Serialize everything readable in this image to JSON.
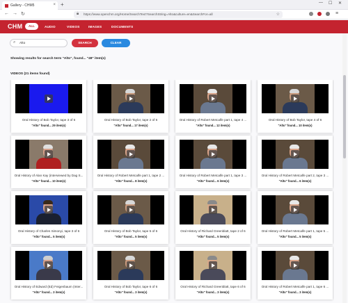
{
  "browser": {
    "tab_title": "Gallery - CHM5",
    "url": "https://www.openchm.org/Home/SearchText?SearchString=Alto&culture=en&SearchFor=all",
    "new_tab": "+",
    "tab_close": "×",
    "minimize": "—",
    "maximize": "☐",
    "close": "✕"
  },
  "site": {
    "logo": "CHM",
    "nav": [
      "ALL",
      "AUDIO",
      "VIDEOS",
      "IMAGES",
      "DOCUMENTS"
    ],
    "active_nav": "ALL",
    "brand_color": "#c4232f"
  },
  "search": {
    "value": "Alto",
    "search_label": "SEARCH",
    "clear_label": "CLEAR",
    "results_message": "Showing results for search term \"Alto\", found... \"49\" item(s)"
  },
  "videos": {
    "heading": "VIDEOS (21 items found)",
    "items": [
      {
        "title": "Oral History of Bob Taylor, tape 3 of 6",
        "found": "\"Alto\" found... 29 item(s)",
        "thumb": "blue"
      },
      {
        "title": "Oral History of Bob Taylor, tape 2 of 6",
        "found": "\"Alto\" found... 17 item(s)",
        "thumb": "office"
      },
      {
        "title": "Oral History of Robert Metcalfe part 1, tape 4 ...",
        "found": "\"Alto\" found... 12 item(s)",
        "thumb": "books"
      },
      {
        "title": "Oral History of Bob Taylor, tape 4 of 6",
        "found": "\"Alto\" found... 10 item(s)",
        "thumb": "office"
      },
      {
        "title": "Oral History of Alan Kay (interviewed by Dag S...",
        "found": "\"Alto\" found... 10 item(s)",
        "thumb": "red"
      },
      {
        "title": "Oral History of Robert Metcalfe part 1, tape 2 ...",
        "found": "\"Alto\" found... 8 item(s)",
        "thumb": "books"
      },
      {
        "title": "Oral History of Robert Metcalfe part 1, tape 3 ...",
        "found": "\"Alto\" found... 6 item(s)",
        "thumb": "books"
      },
      {
        "title": "Oral History of Robert Metcalfe part 2, tape 3 ...",
        "found": "\"Alto\" found... 6 item(s)",
        "thumb": "books"
      },
      {
        "title": "Oral History of Charles Simonyi, tape 3 of 6",
        "found": "\"Alto\" found... 5 item(s)",
        "thumb": "blue-suit"
      },
      {
        "title": "Oral History of Bob Taylor, tape 5 of 6",
        "found": "\"Alto\" found... 5 item(s)",
        "thumb": "office"
      },
      {
        "title": "Oral History of Richard Greenblatt, tape 2 of 6",
        "found": "\"Alto\" found... 5 item(s)",
        "thumb": "tan"
      },
      {
        "title": "Oral History of Robert Metcalfe part 1, tape 5 ...",
        "found": "\"Alto\" found... 5 item(s)",
        "thumb": "books"
      },
      {
        "title": "Oral History of Edward (Ed) Feigenbaum (Inter...",
        "found": "\"Alto\" found... 3 item(s)",
        "thumb": "blue-light"
      },
      {
        "title": "Oral History of Bob Taylor, tape 6 of 6",
        "found": "\"Alto\" found... 3 item(s)",
        "thumb": "office"
      },
      {
        "title": "Oral History of Richard Greenblatt, tape 6 of 6",
        "found": "\"Alto\" found... 3 item(s)",
        "thumb": "tan"
      },
      {
        "title": "Oral History of Robert Metcalfe part 1, tape 6 ...",
        "found": "\"Alto\" found... 3 item(s)",
        "thumb": "books"
      }
    ]
  }
}
